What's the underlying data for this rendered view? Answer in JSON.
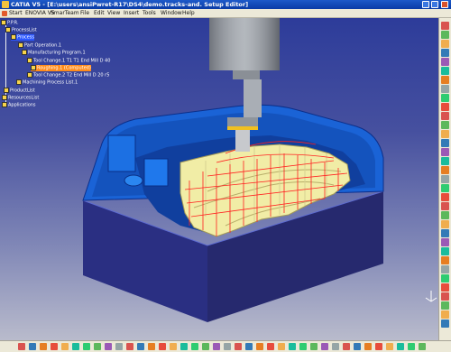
{
  "window": {
    "title": "CATIA V5 - [E:\\users\\ansiPwret-R17\\DS4\\demo.tracks-and. Setup Editor]"
  },
  "menu": {
    "items": [
      "Start",
      "ENOVIA V5",
      "SmarTeam",
      "File",
      "Edit",
      "View",
      "Insert",
      "Tools",
      "Window",
      "Help"
    ]
  },
  "tree": {
    "root": "P.P.R.",
    "process_list": "ProcessList",
    "process": "Process",
    "part_operation": "Part Operation.1",
    "manufacturing_program": "Manufacturing Program.1",
    "tool_change_1": "Tool Change.1  T1 T1 End Mill D 40",
    "operation": "Roughing.1 (Computed)",
    "tool_change_2": "Tool Change.2  T2 End Mill D 20 r5",
    "machining_process_list": "Machining Process List.1",
    "product_list": "ProductList",
    "resources_list": "ResourcesList",
    "applications": "Applications"
  },
  "colors": {
    "viewport_bg": "#3a4aa0",
    "stock_blue": "#1a63d6",
    "stock_shadow": "#0d2f88",
    "toolpath": "#ff2020",
    "machined_surface": "#f1eda6",
    "tool_holder": "#9aa0a8",
    "tool_ring": "#f0c020"
  },
  "compass": {
    "axes": [
      "x",
      "y",
      "z"
    ]
  }
}
